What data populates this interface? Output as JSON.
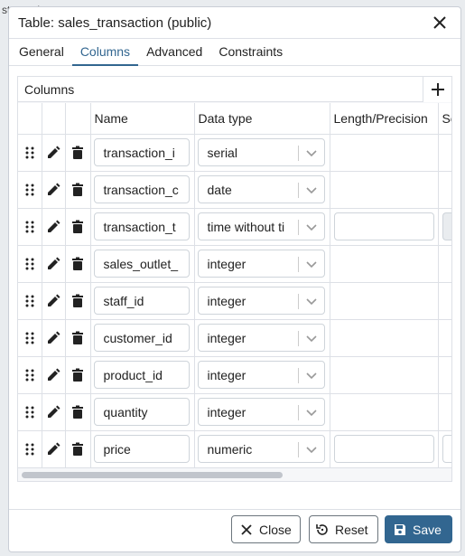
{
  "background": {
    "label": "stgresql"
  },
  "dialog": {
    "title": "Table: sales_transaction (public)",
    "tabs": [
      {
        "label": "General",
        "active": false
      },
      {
        "label": "Columns",
        "active": true
      },
      {
        "label": "Advanced",
        "active": false
      },
      {
        "label": "Constraints",
        "active": false
      }
    ],
    "columns_panel": {
      "title": "Columns",
      "headers": {
        "name": "Name",
        "data_type": "Data type",
        "length": "Length/Precision",
        "scale": "Sc"
      },
      "rows": [
        {
          "name": "transaction_i",
          "type": "serial",
          "length_editable": false
        },
        {
          "name": "transaction_c",
          "type": "date",
          "length_editable": false
        },
        {
          "name": "transaction_t",
          "type": "time without ti",
          "length_editable": true,
          "scale_disabled": true
        },
        {
          "name": "sales_outlet_",
          "type": "integer",
          "length_editable": false
        },
        {
          "name": "staff_id",
          "type": "integer",
          "length_editable": false
        },
        {
          "name": "customer_id",
          "type": "integer",
          "length_editable": false
        },
        {
          "name": "product_id",
          "type": "integer",
          "length_editable": false
        },
        {
          "name": "quantity",
          "type": "integer",
          "length_editable": false
        },
        {
          "name": "price",
          "type": "numeric",
          "length_editable": true,
          "scale_disabled": false
        }
      ]
    },
    "footer": {
      "close_label": "Close",
      "reset_label": "Reset",
      "save_label": "Save"
    }
  },
  "colors": {
    "accent": "#326690",
    "border": "#dde0e6"
  }
}
